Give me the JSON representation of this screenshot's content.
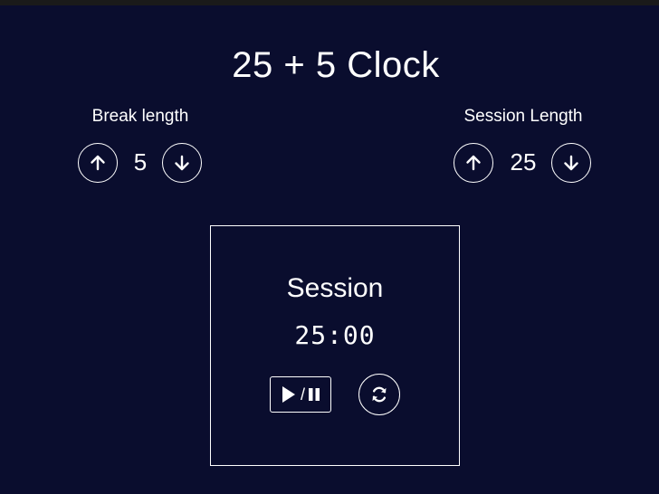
{
  "app": {
    "title": "25 + 5 Clock",
    "background_color": "#0a0d2e",
    "foreground_color": "#ffffff"
  },
  "break_control": {
    "label": "Break length",
    "value": "5",
    "increment_icon": "arrow-up-icon",
    "decrement_icon": "arrow-down-icon"
  },
  "session_control": {
    "label": "Session Length",
    "value": "25",
    "increment_icon": "arrow-up-icon",
    "decrement_icon": "arrow-down-icon"
  },
  "timer": {
    "label": "Session",
    "time_left": "25:00",
    "start_stop_icons": [
      "play-icon",
      "pause-icon"
    ],
    "start_stop_separator": "/",
    "reset_icon": "refresh-icon"
  }
}
